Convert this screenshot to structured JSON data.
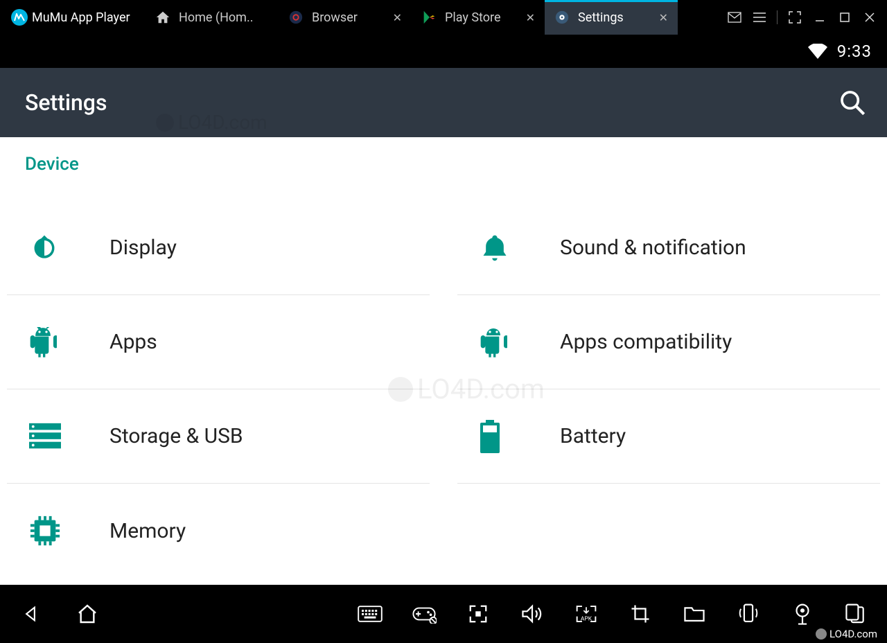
{
  "emulator": {
    "app_name": "MuMu App Player",
    "tabs": [
      {
        "label": "Home (Hom..",
        "icon": "home",
        "closeable": false
      },
      {
        "label": "Browser",
        "icon": "browser",
        "closeable": true
      },
      {
        "label": "Play Store",
        "icon": "play",
        "closeable": true
      },
      {
        "label": "Settings",
        "icon": "gear",
        "closeable": true,
        "active": true
      }
    ]
  },
  "status": {
    "time": "9:33"
  },
  "action_bar": {
    "title": "Settings"
  },
  "section": {
    "header": "Device"
  },
  "items": {
    "display": "Display",
    "sound": "Sound & notification",
    "apps": "Apps",
    "apps_compat": "Apps compatibility",
    "storage": "Storage & USB",
    "battery": "Battery",
    "memory": "Memory"
  },
  "watermark": {
    "text": "LO4D.com"
  },
  "colors": {
    "accent": "#009688",
    "tab_highlight": "#00b5e2"
  }
}
